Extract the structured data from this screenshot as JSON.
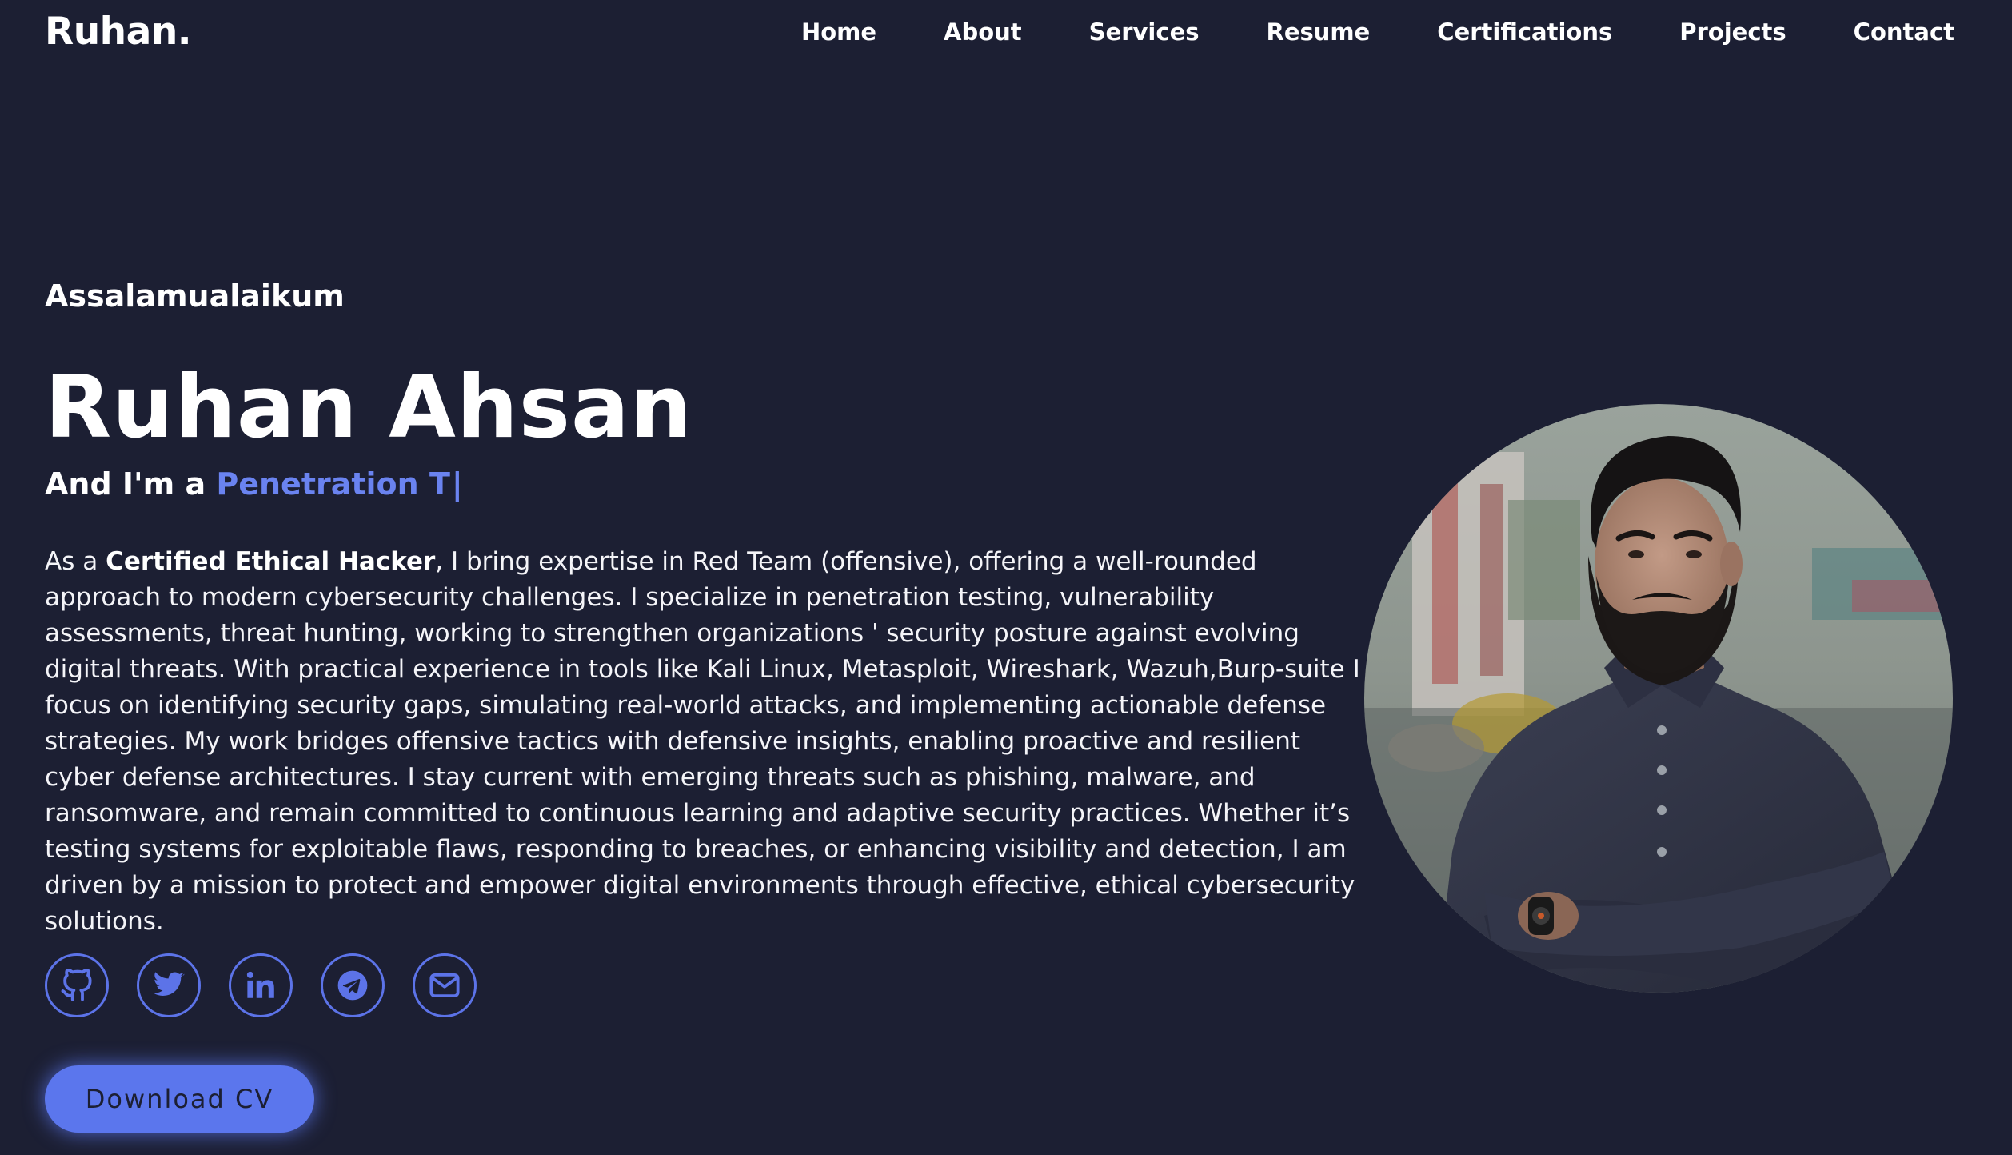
{
  "header": {
    "logo": "Ruhan.",
    "nav": [
      {
        "label": "Home"
      },
      {
        "label": "About"
      },
      {
        "label": "Services"
      },
      {
        "label": "Resume"
      },
      {
        "label": "Certifications"
      },
      {
        "label": "Projects"
      },
      {
        "label": "Contact"
      }
    ]
  },
  "hero": {
    "greeting": "Assalamualaikum",
    "name": "Ruhan Ahsan",
    "role_prefix": "And I'm a ",
    "role_typed": "Penetration T",
    "role_cursor": "|",
    "bio_intro": "As a ",
    "bio_bold": "Certified Ethical Hacker",
    "bio_rest": ", I bring expertise in Red Team (offensive), offering a well-rounded approach to modern cybersecurity challenges. I specialize in penetration testing, vulnerability assessments, threat hunting, working to strengthen organizations ' security posture against evolving digital threats. With practical experience in tools like Kali Linux, Metasploit, Wireshark, Wazuh,Burp-suite I focus on identifying security gaps, simulating real-world attacks, and implementing actionable defense strategies. My work bridges offensive tactics with defensive insights, enabling proactive and resilient cyber defense architectures. I stay current with emerging threats such as phishing, malware, and ransomware, and remain committed to continuous learning and adaptive security practices. Whether it’s testing systems for exploitable flaws, responding to breaches, or enhancing visibility and detection, I am driven by a mission to protect and empower digital environments through effective, ethical cybersecurity solutions.",
    "socials": [
      {
        "icon": "github-icon"
      },
      {
        "icon": "twitter-icon"
      },
      {
        "icon": "linkedin-icon"
      },
      {
        "icon": "telegram-icon"
      },
      {
        "icon": "mail-icon"
      }
    ],
    "cv_button": "Download CV"
  },
  "colors": {
    "background": "#1c1f33",
    "accent": "#5b76ed",
    "text": "#ffffff"
  }
}
